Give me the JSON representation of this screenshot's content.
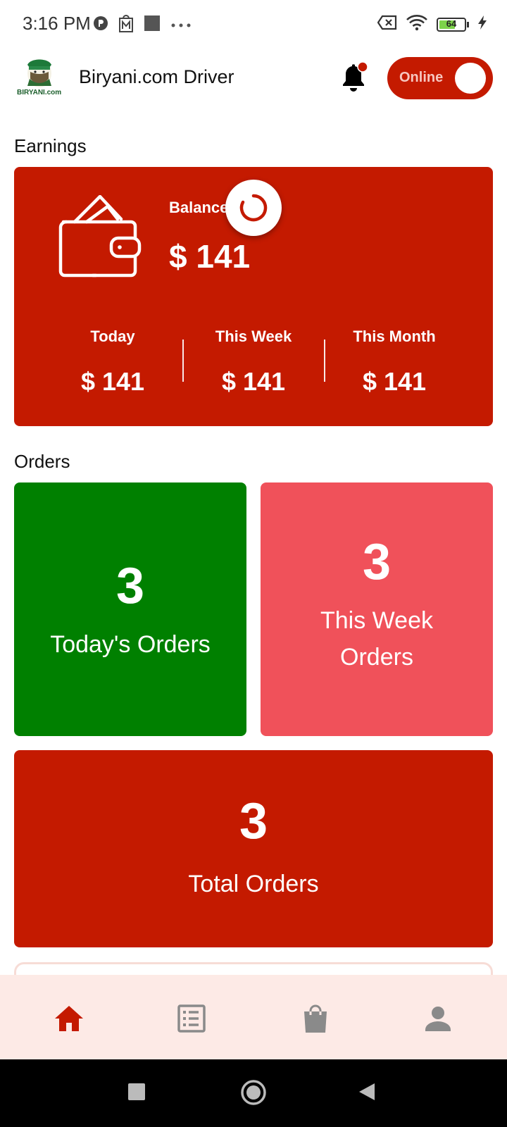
{
  "status_bar": {
    "time": "3:16 PM",
    "battery_level": "64",
    "battery_fraction": 0.64,
    "icons_left": [
      "p-icon",
      "m-shop-icon",
      "square-icon",
      "more-dots-icon"
    ],
    "icons_right": [
      "x-box-icon",
      "wifi-icon",
      "battery-icon",
      "charging-bolt-icon"
    ]
  },
  "header": {
    "logo_text": "BIRYANI.com",
    "title": "Biryani.com Driver",
    "online_label": "Online",
    "has_notification": true
  },
  "earnings": {
    "section_title": "Earnings",
    "balance_label": "Balance",
    "balance_value": "$ 141",
    "stats": [
      {
        "label": "Today",
        "value": "$ 141"
      },
      {
        "label": "This Week",
        "value": "$ 141"
      },
      {
        "label": "This Month",
        "value": "$ 141"
      }
    ]
  },
  "orders": {
    "section_title": "Orders",
    "today": {
      "count": "3",
      "label": "Today's Orders"
    },
    "week": {
      "count": "3",
      "label_line1": "This Week",
      "label_line2": "Orders"
    },
    "total": {
      "count": "3",
      "label": "Total Orders"
    }
  },
  "bottom_nav": {
    "items": [
      "home-icon",
      "list-icon",
      "shopping-bag-icon",
      "profile-icon"
    ],
    "active": "home"
  },
  "colors": {
    "brand_red": "#c41a00",
    "green": "#008000",
    "light_red": "#f0515a",
    "nav_bg": "#fdeae6"
  }
}
